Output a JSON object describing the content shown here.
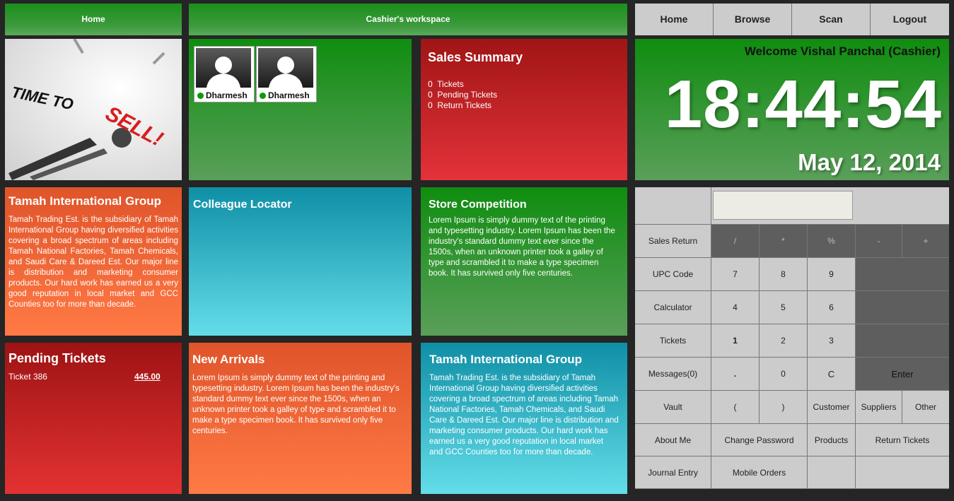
{
  "topbar": {
    "home_label": "Home",
    "workspace_label": "Cashier's workspace"
  },
  "nav": {
    "home": "Home",
    "browse": "Browse",
    "scan": "Scan",
    "logout": "Logout"
  },
  "sell_image": {
    "line1": "TIME TO",
    "line2": "SELL!"
  },
  "colleagues": [
    {
      "name": "Dharmesh",
      "status": "online"
    },
    {
      "name": "Dharmesh",
      "status": "online"
    }
  ],
  "sales_summary": {
    "title": "Sales Summary",
    "tickets_count": "0",
    "tickets_label": "Tickets",
    "pending_count": "0",
    "pending_label": "Pending Tickets",
    "return_count": "0",
    "return_label": "Return Tickets"
  },
  "clock": {
    "welcome": "Welcome Vishal Panchal (Cashier)",
    "time": "18:44:54",
    "date": "May 12, 2014"
  },
  "tamah1": {
    "title": "Tamah International Group",
    "body": "Tamah Trading Est. is the subsidiary of Tamah International Group having diversified activities covering a broad spectrum of areas including Tamah National Factories, Tamah Chemicals, and Saudi Care & Dareed Est. Our major line is distribution and marketing consumer products. Our hard work has earned us a very good reputation in local market and GCC Counties too for more than decade."
  },
  "colleague_locator": {
    "title": "Colleague Locator"
  },
  "store_competition": {
    "title": "Store Competition",
    "body": "Lorem Ipsum is simply dummy text of the printing and typesetting industry. Lorem Ipsum has been the industry's standard dummy text ever since the 1500s, when an unknown printer took a galley of type and scrambled it to make a type specimen book. It has survived only five centuries."
  },
  "pending_tickets": {
    "title": "Pending Tickets",
    "rows": [
      {
        "ticket": "Ticket 386",
        "amount": "445.00"
      }
    ]
  },
  "new_arrivals": {
    "title": "New Arrivals",
    "body": "Lorem Ipsum is simply dummy text of the printing and typesetting industry. Lorem Ipsum has been the industry's standard dummy text ever since the 1500s, when an unknown printer took a galley of type and scrambled it to make a type specimen book. It has survived only five centuries."
  },
  "tamah2": {
    "title": "Tamah International Group",
    "body": "Tamah Trading Est. is the subsidiary of Tamah International Group having diversified activities covering a broad spectrum of areas including Tamah National Factories, Tamah Chemicals, and Saudi Care & Dareed Est. Our major line is distribution and marketing consumer products. Our hard work has earned us a very good reputation in local market and GCC Counties too for more than decade."
  },
  "keypad": {
    "display_value": "",
    "sales_return": "Sales Return",
    "upc_code": "UPC Code",
    "calculator": "Calculator",
    "tickets": "Tickets",
    "messages": "Messages(0)",
    "vault": "Vault",
    "about_me": "About Me",
    "journal_entry": "Journal Entry",
    "op_div": "/",
    "op_mul": "*",
    "op_pct": "%",
    "op_minus": "-",
    "op_plus": "+",
    "k7": "7",
    "k8": "8",
    "k9": "9",
    "k4": "4",
    "k5": "5",
    "k6": "6",
    "k1": "1",
    "k2": "2",
    "k3": "3",
    "kdot": ".",
    "k0": "0",
    "kc": "C",
    "enter": "Enter",
    "paren_open": "(",
    "paren_close": ")",
    "customer": "Customer",
    "suppliers": "Suppliers",
    "other": "Other",
    "change_password": "Change Password",
    "products": "Products",
    "return_tickets": "Return Tickets",
    "mobile_orders": "Mobile Orders"
  }
}
